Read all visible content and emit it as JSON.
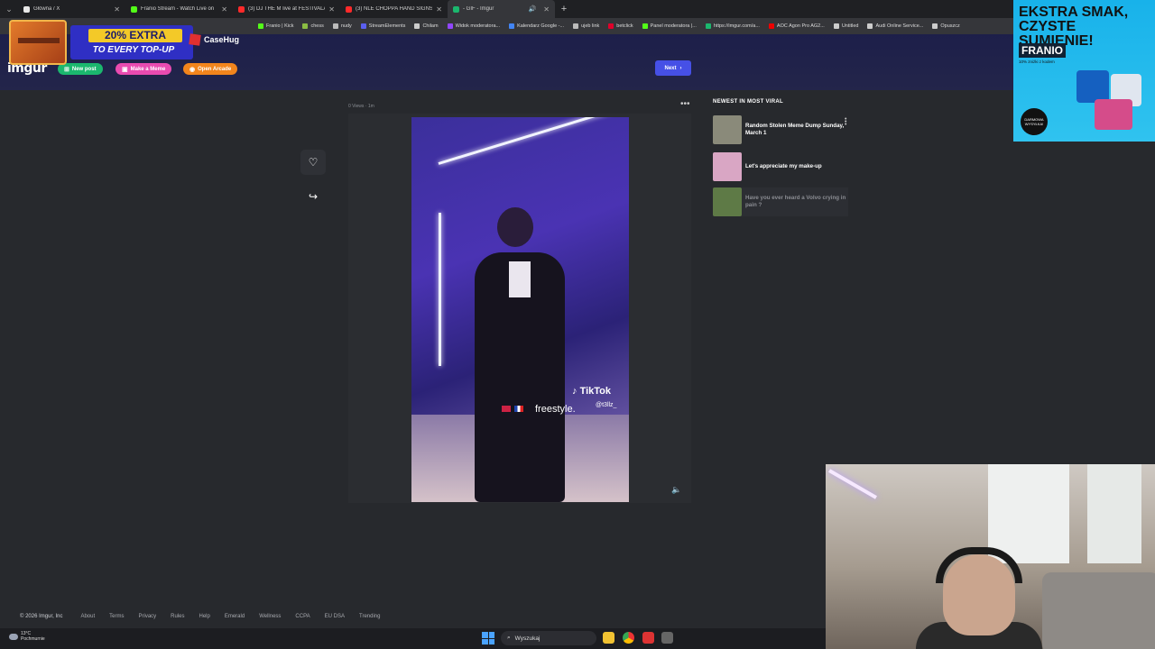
{
  "browser": {
    "tabs": [
      {
        "label": "Główna / X",
        "color": "#e8e8e8"
      },
      {
        "label": "Franio Stream - Watch Live on",
        "color": "#53fc18"
      },
      {
        "label": "(3) DJ THE M live at FESTIVALA",
        "color": "#ff2a2a"
      },
      {
        "label": "(3) NLE CHOPPA HAND SIGNS",
        "color": "#ff2a2a"
      },
      {
        "label": "- GIF - Imgur",
        "color": "#1bb76e",
        "active": true
      }
    ],
    "bookmarks": [
      {
        "label": "Franio | Kick",
        "color": "#53fc18"
      },
      {
        "label": "chess",
        "color": "#8bbd43"
      },
      {
        "label": "nudy",
        "color": "#bbbbbb"
      },
      {
        "label": "StreamElements",
        "color": "#5a5ff0"
      },
      {
        "label": "Chilam",
        "color": "#cccccc"
      },
      {
        "label": "Widok moderatora...",
        "color": "#9146ff"
      },
      {
        "label": "Kalendarz Google -...",
        "color": "#4285f4"
      },
      {
        "label": "ujeb link",
        "color": "#bbbbbb"
      },
      {
        "label": "betclick",
        "color": "#e0002a"
      },
      {
        "label": "Panel moderatora |...",
        "color": "#53fc18"
      },
      {
        "label": "https://imgur.com/a...",
        "color": "#1bb76e"
      },
      {
        "label": "AOC Agon Pro AG2...",
        "color": "#e00"
      },
      {
        "label": "Untitled",
        "color": "#ccc"
      },
      {
        "label": "Audi Online Service...",
        "color": "#ccc"
      },
      {
        "label": "Opuszcz",
        "color": "#ccc"
      }
    ]
  },
  "promo": {
    "line1": "20% EXTRA",
    "line2": "TO EVERY TOP-UP",
    "brand": "CaseHug"
  },
  "imgur": {
    "logo": "imgur",
    "new_post": "New post",
    "make_meme": "Make a Meme",
    "open_arcade": "Open Arcade",
    "next": "Next",
    "colors": {
      "new_post": "#1bb76e",
      "make_meme": "#e94bb0",
      "open_arcade": "#f2851c",
      "next": "#4650e6"
    }
  },
  "post": {
    "meta": "0 Views · 1m",
    "video_caption": "freestyle.",
    "tiktok": "TikTok",
    "handle": "@t3llz_"
  },
  "sidebar": {
    "title": "NEWEST IN MOST VIRAL",
    "items": [
      {
        "title": "Random Stolen Meme Dump Sunday, March 1",
        "thumb": "#8a8a7a"
      },
      {
        "title": "Let's appreciate my make-up",
        "thumb": "#d9a6c4"
      },
      {
        "title": "Have you ever heard a Volvo crying in pain ?",
        "thumb": "#5e7a46"
      }
    ]
  },
  "footer": {
    "copyright": "© 2026 Imgur, Inc",
    "links": [
      "About",
      "Terms",
      "Privacy",
      "Rules",
      "Help",
      "Emerald",
      "Wellness",
      "CCPA",
      "EU DSA",
      "Trending"
    ]
  },
  "taskbar": {
    "temp": "13°C",
    "weather": "Pochmurnie",
    "search": "Wyszukaj"
  },
  "ad": {
    "headline": "EKSTRA SMAK, CZYSTE SUMIENIE!",
    "brand": "FRANIO",
    "sub": "10% zniżki z kodem",
    "badge": "DARMOWA WYSYŁKA!"
  }
}
